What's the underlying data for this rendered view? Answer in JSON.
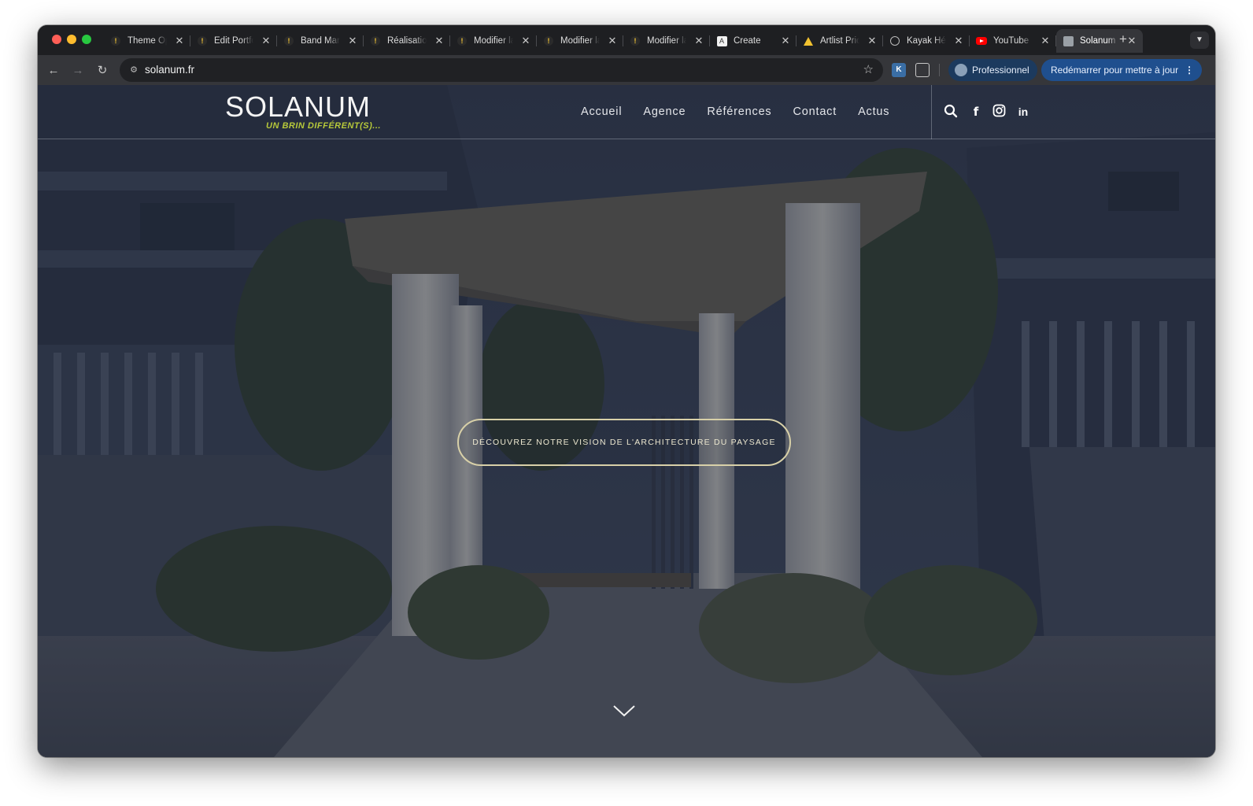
{
  "browser": {
    "tabs": [
      {
        "title": "Theme Options",
        "favicon": "wordpress-icon",
        "active": false
      },
      {
        "title": "Edit Portfolio",
        "favicon": "wordpress-icon",
        "active": false
      },
      {
        "title": "Band Marquee",
        "favicon": "wordpress-icon",
        "active": false
      },
      {
        "title": "Réalisations",
        "favicon": "wordpress-icon",
        "active": false
      },
      {
        "title": "Modifier la page",
        "favicon": "wordpress-icon",
        "active": false
      },
      {
        "title": "Modifier la page",
        "favicon": "wordpress-icon",
        "active": false
      },
      {
        "title": "Modifier la page",
        "favicon": "wordpress-icon",
        "active": false
      },
      {
        "title": "Create",
        "favicon": "create-icon",
        "active": false
      },
      {
        "title": "Artlist Pricing",
        "favicon": "artlist-icon",
        "active": false
      },
      {
        "title": "Kayak Hérault",
        "favicon": "globe-icon",
        "active": false
      },
      {
        "title": "YouTube",
        "favicon": "youtube-icon",
        "active": false
      },
      {
        "title": "Solanum",
        "favicon": "solanum-icon",
        "active": true
      }
    ],
    "new_tab": "+",
    "url": "solanum.fr",
    "profile_label": "Professionnel",
    "update_label": "Redémarrer pour mettre à jour"
  },
  "site": {
    "logo_main": "SOLANUM",
    "logo_tagline": "UN BRIN DIFFÉRENT(S)...",
    "nav": [
      {
        "label": "Accueil"
      },
      {
        "label": "Agence"
      },
      {
        "label": "Références"
      },
      {
        "label": "Contact"
      },
      {
        "label": "Actus"
      }
    ],
    "header_icons": [
      "search-icon",
      "facebook-icon",
      "instagram-icon",
      "linkedin-icon"
    ],
    "cta_label": "DÉCOUVREZ NOTRE VISION DE L'ARCHITECTURE DU PAYSAGE",
    "colors": {
      "logo_tagline": "#b7c93a",
      "cta_border": "#d8d0a8",
      "overlay": "#2e3648"
    }
  }
}
